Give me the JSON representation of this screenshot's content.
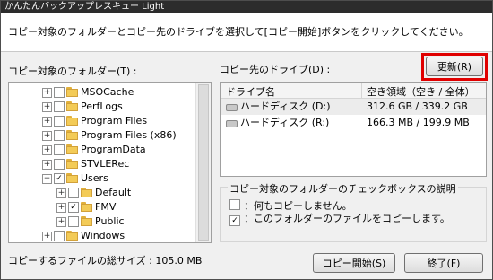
{
  "window": {
    "title": "かんたんバックアップレスキュー Light"
  },
  "header": {
    "instruction": "コピー対象のフォルダーとコピー先のドライブを選択して[コピー開始]ボタンをクリックしてください。"
  },
  "folders": {
    "label": "コピー対象のフォルダー(T) :",
    "items": [
      {
        "name": "MSOCache",
        "checked": false,
        "expander": "+"
      },
      {
        "name": "PerfLogs",
        "checked": false,
        "expander": "+"
      },
      {
        "name": "Program Files",
        "checked": false,
        "expander": "+"
      },
      {
        "name": "Program Files (x86)",
        "checked": false,
        "expander": "+"
      },
      {
        "name": "ProgramData",
        "checked": false,
        "expander": "+"
      },
      {
        "name": "STVLERec",
        "checked": false,
        "expander": "+"
      },
      {
        "name": "Users",
        "checked": true,
        "expander": "−"
      },
      {
        "name": "Default",
        "checked": false,
        "expander": "+"
      },
      {
        "name": "FMV",
        "checked": true,
        "expander": "+"
      },
      {
        "name": "Public",
        "checked": false,
        "expander": "+"
      },
      {
        "name": "Windows",
        "checked": false,
        "expander": "+"
      }
    ]
  },
  "drives": {
    "label": "コピー先のドライブ(D) :",
    "refresh_label": "更新(R)",
    "columns": [
      "ドライブ名",
      "空き領域（空き / 全体）"
    ],
    "rows": [
      {
        "name": "ハードディスク (D:)",
        "space": "312.6 GB / 339.2 GB"
      },
      {
        "name": "ハードディスク (R:)",
        "space": "166.3 MB / 199.9 MB"
      }
    ]
  },
  "legend": {
    "title": "コピー対象のフォルダーのチェックボックスの説明",
    "unchecked": "：何もコピーしません。",
    "checked": "：このフォルダーのファイルをコピーします。"
  },
  "footer": {
    "total_size": "コピーするファイルの総サイズ : 105.0 MB",
    "start_label": "コピー開始(S)",
    "exit_label": "終了(F)"
  },
  "colors": {
    "highlight": "#e00000"
  }
}
